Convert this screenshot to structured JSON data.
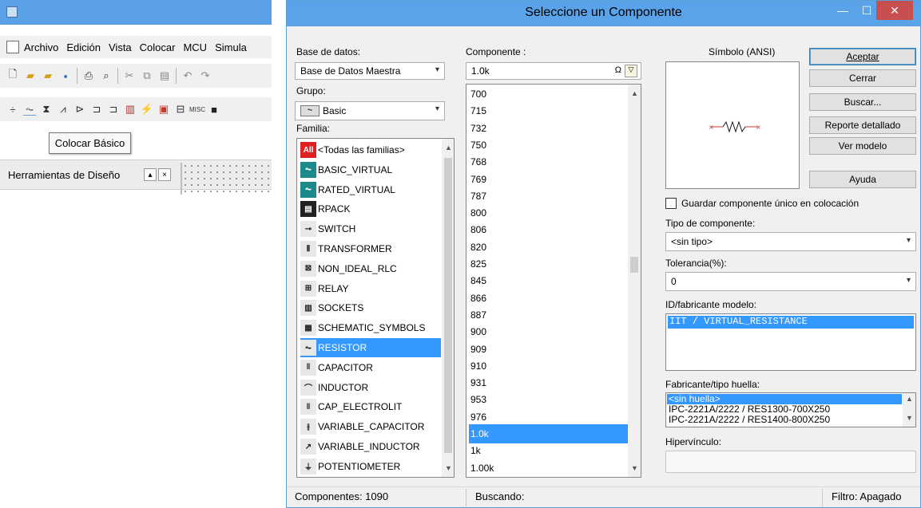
{
  "app": {
    "menu": [
      "Archivo",
      "Edición",
      "Vista",
      "Colocar",
      "MCU",
      "Simula"
    ],
    "tooltip": "Colocar Básico",
    "design_panel_title": "Herramientas de Diseño",
    "toolbar2_misc_label": "MISC"
  },
  "dialog": {
    "title": "Seleccione un Componente",
    "database_label": "Base de datos:",
    "database_value": "Base de Datos Maestra",
    "group_label": "Grupo:",
    "group_value": "Basic",
    "family_label": "Familia:",
    "families": [
      {
        "label": "<Todas las familias>",
        "icon": "all-families-icon"
      },
      {
        "label": "BASIC_VIRTUAL",
        "icon": "basic-virtual-icon"
      },
      {
        "label": "RATED_VIRTUAL",
        "icon": "rated-virtual-icon"
      },
      {
        "label": "RPACK",
        "icon": "rpack-icon"
      },
      {
        "label": "SWITCH",
        "icon": "switch-icon"
      },
      {
        "label": "TRANSFORMER",
        "icon": "transformer-icon"
      },
      {
        "label": "NON_IDEAL_RLC",
        "icon": "non-ideal-rlc-icon"
      },
      {
        "label": "RELAY",
        "icon": "relay-icon"
      },
      {
        "label": "SOCKETS",
        "icon": "sockets-icon"
      },
      {
        "label": "SCHEMATIC_SYMBOLS",
        "icon": "schematic-symbols-icon"
      },
      {
        "label": "RESISTOR",
        "icon": "resistor-icon",
        "selected": true
      },
      {
        "label": "CAPACITOR",
        "icon": "capacitor-icon"
      },
      {
        "label": "INDUCTOR",
        "icon": "inductor-icon"
      },
      {
        "label": "CAP_ELECTROLIT",
        "icon": "cap-electrolit-icon"
      },
      {
        "label": "VARIABLE_CAPACITOR",
        "icon": "variable-capacitor-icon"
      },
      {
        "label": "VARIABLE_INDUCTOR",
        "icon": "variable-inductor-icon"
      },
      {
        "label": "POTENTIOMETER",
        "icon": "potentiometer-icon"
      }
    ],
    "component_label": "Componente :",
    "component_value": "1.0k",
    "components": [
      "700",
      "715",
      "732",
      "750",
      "768",
      "769",
      "787",
      "800",
      "806",
      "820",
      "825",
      "845",
      "866",
      "887",
      "900",
      "909",
      "910",
      "931",
      "953",
      "976",
      "1.0k",
      "1k",
      "1.00k"
    ],
    "selected_component": "1.0k",
    "symbol_label": "Símbolo (ANSI)",
    "buttons": {
      "accept": "Aceptar",
      "close": "Cerrar",
      "search": "Buscar...",
      "detailed_report": "Reporte detallado",
      "view_model": "Ver modelo",
      "help": "Ayuda"
    },
    "save_unique_label": "Guardar componente único en colocación",
    "component_type_label": "Tipo de componente:",
    "component_type_value": "<sin tipo>",
    "tolerance_label": "Tolerancia(%):",
    "tolerance_value": "0",
    "model_label": "ID/fabricante modelo:",
    "model_items": [
      "IIT / VIRTUAL_RESISTANCE"
    ],
    "footprint_label": "Fabricante/tipo huella:",
    "footprint_items": [
      "<sin huella>",
      "IPC-2221A/2222 / RES1300-700X250",
      "IPC-2221A/2222 / RES1400-800X250"
    ],
    "hyperlink_label": "Hipervínculo:",
    "status": {
      "components": "Componentes: 1090",
      "searching": "Buscando:",
      "filter": "Filtro: Apagado"
    }
  }
}
